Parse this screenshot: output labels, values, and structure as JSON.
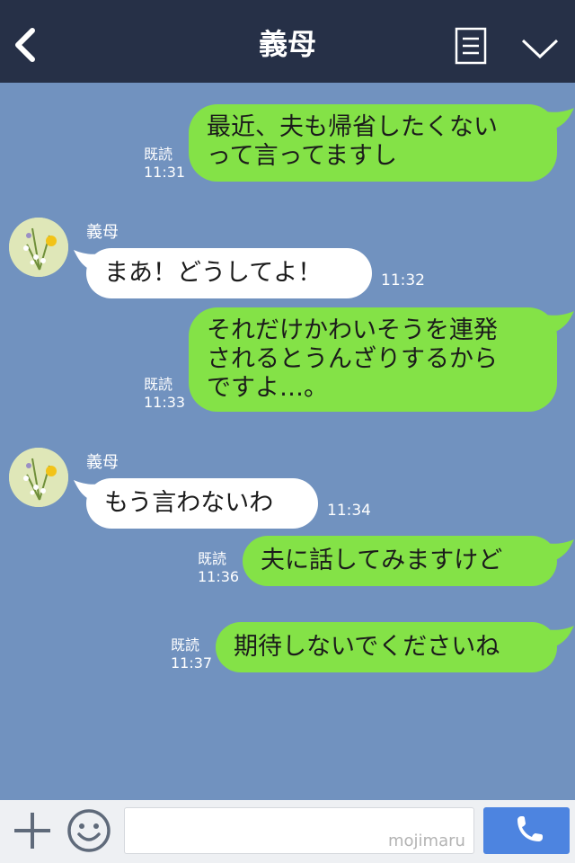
{
  "header": {
    "title": "義母",
    "back_icon": "chevron-left-icon",
    "menu_icon": "notes-icon",
    "expand_icon": "chevron-down-icon"
  },
  "messages": [
    {
      "id": "m1",
      "direction": "out",
      "text": "最近、夫も帰省したくない\nって言ってますし",
      "read": "既読",
      "time": "11:31"
    },
    {
      "id": "m2",
      "direction": "in",
      "sender": "義母",
      "text": "まあ！どうしてよ！",
      "time": "11:32"
    },
    {
      "id": "m3",
      "direction": "out",
      "text": "それだけかわいそうを連発\nされるとうんざりするから\nですよ…。",
      "read": "既読",
      "time": "11:33"
    },
    {
      "id": "m4",
      "direction": "in",
      "sender": "義母",
      "text": "もう言わないわ",
      "time": "11:34"
    },
    {
      "id": "m5",
      "direction": "out",
      "text": "夫に話してみますけど",
      "read": "既読",
      "time": "11:36"
    },
    {
      "id": "m6",
      "direction": "out",
      "text": "期待しないでくださいね",
      "read": "既読",
      "time": "11:37"
    }
  ],
  "input": {
    "placeholder": "",
    "watermark": "mojimaru"
  },
  "colors": {
    "header_bg": "#263047",
    "chat_bg": "#7192bf",
    "outgoing_bubble": "#84e247",
    "incoming_bubble": "#ffffff",
    "call_button": "#4d84e0"
  }
}
